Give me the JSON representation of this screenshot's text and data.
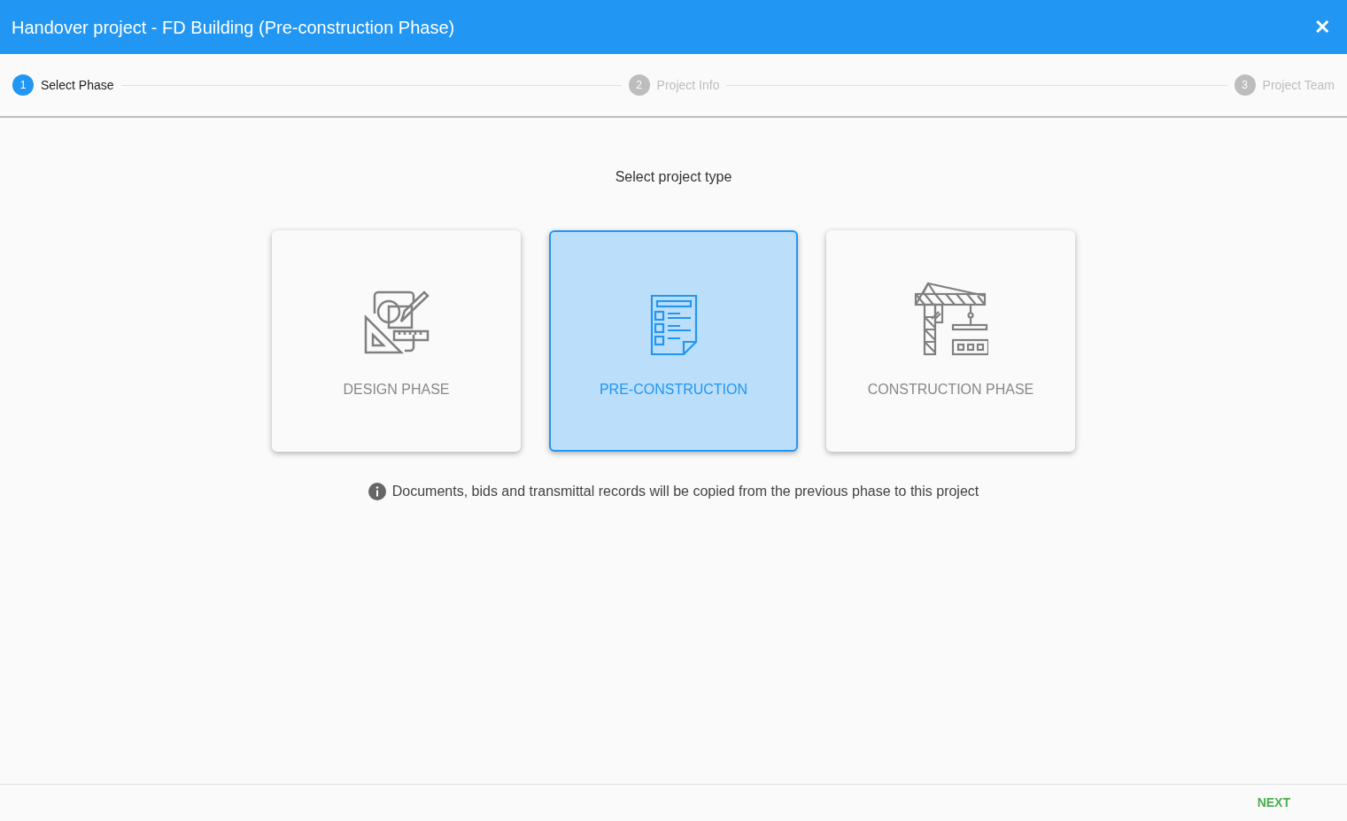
{
  "window": {
    "title": "Handover project - FD Building (Pre-construction Phase)",
    "close": "✕"
  },
  "steps": [
    {
      "number": "1",
      "label": "Select Phase",
      "selected": true
    },
    {
      "number": "2",
      "label": "Project Info",
      "selected": false
    },
    {
      "number": "3",
      "label": "Project Team",
      "selected": false
    }
  ],
  "prompt": "Select project type",
  "cards": [
    {
      "kind": "design",
      "label": "DESIGN PHASE",
      "selected": false
    },
    {
      "kind": "preconstruction",
      "label": "PRE-CONSTRUCTION",
      "selected": true
    },
    {
      "kind": "construction",
      "label": "CONSTRUCTION PHASE",
      "selected": false
    }
  ],
  "info": "Documents, bids and transmittal records will be copied from the previous phase to this project",
  "footer": {
    "next": "NEXT"
  }
}
